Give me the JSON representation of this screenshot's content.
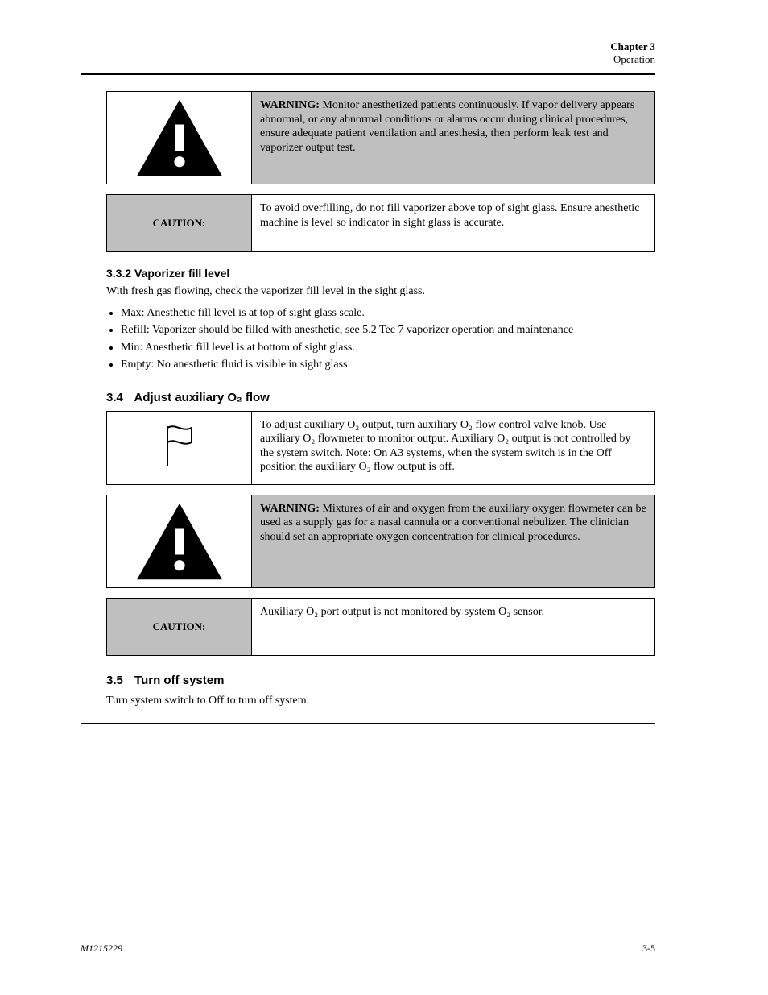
{
  "header": {
    "chapter_label": "Chapter 3",
    "chapter_title": "Operation"
  },
  "callouts": {
    "warn1": {
      "heading": "WARNING:",
      "body": "Monitor anesthetized patients continuously. If vapor delivery appears abnormal, or any abnormal conditions or alarms occur during clinical procedures, ensure adequate patient ventilation and anesthesia, then perform leak test and vaporizer output test."
    },
    "caution1": {
      "label": "CAUTION:",
      "body": "To avoid overfilling, do not fill vaporizer above top of sight glass. Ensure anesthetic machine is level so indicator in sight glass is accurate."
    },
    "note1": {
      "body": "To adjust auxiliary O₂ output, turn auxiliary O₂ flow control valve knob. Use auxiliary O₂ flowmeter to monitor output. Auxiliary O₂ output is not controlled by the system switch. Note: On A3 systems, when the system switch is in the Off position the auxiliary O₂ flow output is off."
    },
    "warn2": {
      "heading": "WARNING:",
      "body": "Mixtures of air and oxygen from the auxiliary oxygen flowmeter can be used as a supply gas for a nasal cannula or a conventional nebulizer. The clinician should set an appropriate oxygen concentration for clinical procedures."
    },
    "caution2": {
      "label": "CAUTION:",
      "body": "Auxiliary O₂ port output is not monitored by system O₂ sensor."
    }
  },
  "section": {
    "title": "3.3.2  Vaporizer fill level",
    "intro": "With fresh gas flowing, check the vaporizer fill level in the sight glass.",
    "bullets": [
      "Max: Anesthetic fill level is at top of sight glass scale.",
      "Refill: Vaporizer should be filled with anesthetic, see 5.2 Tec 7 vaporizer operation and maintenance",
      "Min: Anesthetic fill level is at bottom of sight glass.",
      "Empty: No anesthetic fluid is visible in sight glass"
    ],
    "steps": [
      {
        "num": "3.4",
        "title": "Adjust auxiliary O₂ flow"
      },
      {
        "num": "3.5",
        "title": "Turn off system"
      }
    ],
    "turn_off": "Turn system switch to Off to turn off system."
  },
  "footer": {
    "docref": "M1215229",
    "pagenum": "3-5"
  }
}
